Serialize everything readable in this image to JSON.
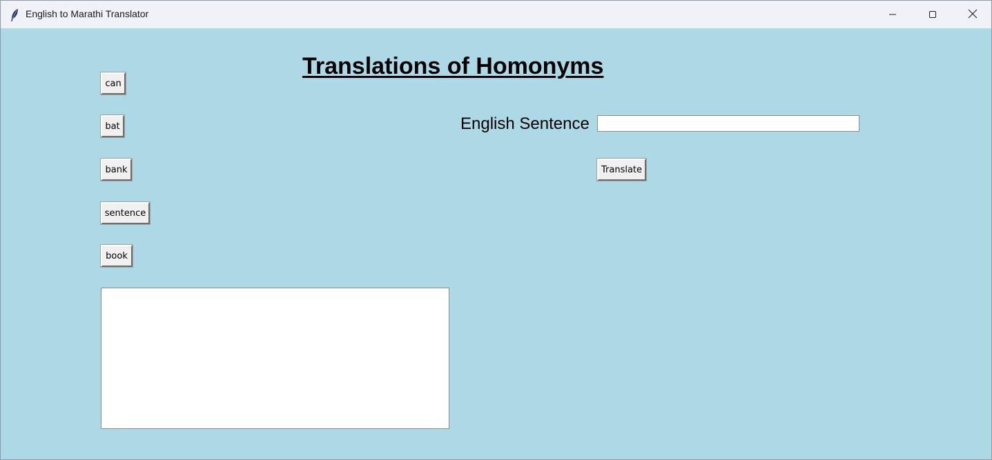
{
  "window": {
    "title": "English to Marathi Translator",
    "app_icon": "feather-icon",
    "controls": {
      "minimize_icon": "minimize-icon",
      "maximize_icon": "maximize-icon",
      "close_icon": "close-icon"
    }
  },
  "colors": {
    "background": "#add8e6",
    "titlebar": "#f1f2f8",
    "button_face": "#f0f0f0"
  },
  "heading": "Translations of Homonyms",
  "homonym_buttons": {
    "can": "can",
    "bat": "bat",
    "bank": "bank",
    "sentence": "sentence",
    "book": "book"
  },
  "translator": {
    "sentence_label": "English Sentence",
    "sentence_value": "",
    "translate_label": "Translate"
  },
  "output": {
    "text": ""
  }
}
